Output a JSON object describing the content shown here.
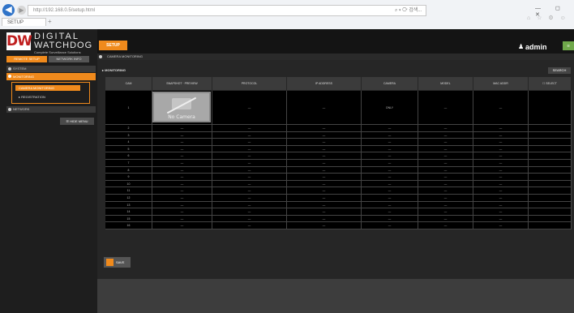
{
  "browser": {
    "address": "http://192.168.0.5/setup.html",
    "address_right": "⌕ ▾ ⟳ 검색...",
    "tab_label": "SETUP",
    "window_controls": "—  ◻  ✕",
    "toolbar_icons": "⌂ ☆ ⚙ ☺"
  },
  "logo": {
    "mark": "DW",
    "line1": "DIGITAL",
    "line2": "WATCHDOG",
    "tagline": "Complete Surveillance Solutions"
  },
  "left_panel": {
    "tabs": [
      "REMOTE SETUP",
      "NETWORK INFO"
    ],
    "section_system": "SYSTEM",
    "section_monitoring": "MONITORING",
    "monitoring_items": [
      "CAMERA MONITORING",
      "REGISTRATION"
    ],
    "section_network": "NETWORK",
    "hide_menu": "☰ HIDE MENU"
  },
  "topbar": {
    "setup": "SETUP",
    "admin_icon": "♟",
    "admin": "admin",
    "admin_btn": "☰"
  },
  "subbar": {
    "title": "CAMERA MONITORING"
  },
  "main": {
    "section_title": "▸ MONITORING",
    "search_btn": "SEARCH",
    "save_btn": "SAVE"
  },
  "table": {
    "headers": [
      "CAM",
      "SNAPSHOT · PREVIEW",
      "PROTOCOL",
      "IP ADDRESS",
      "CAMERA",
      "MODEL",
      "MAC ADDR",
      "☐ SELECT"
    ],
    "no_camera": "No Camera",
    "first_row_status": "ONLY",
    "dash": "—",
    "rows": [
      "1",
      "2",
      "3",
      "4",
      "5",
      "6",
      "7",
      "8",
      "9",
      "10",
      "11",
      "12",
      "13",
      "14",
      "15",
      "16"
    ]
  },
  "colors": {
    "accent": "#f08a1c",
    "bg": "#2b2b2b",
    "admin_btn": "#6fa84a"
  }
}
